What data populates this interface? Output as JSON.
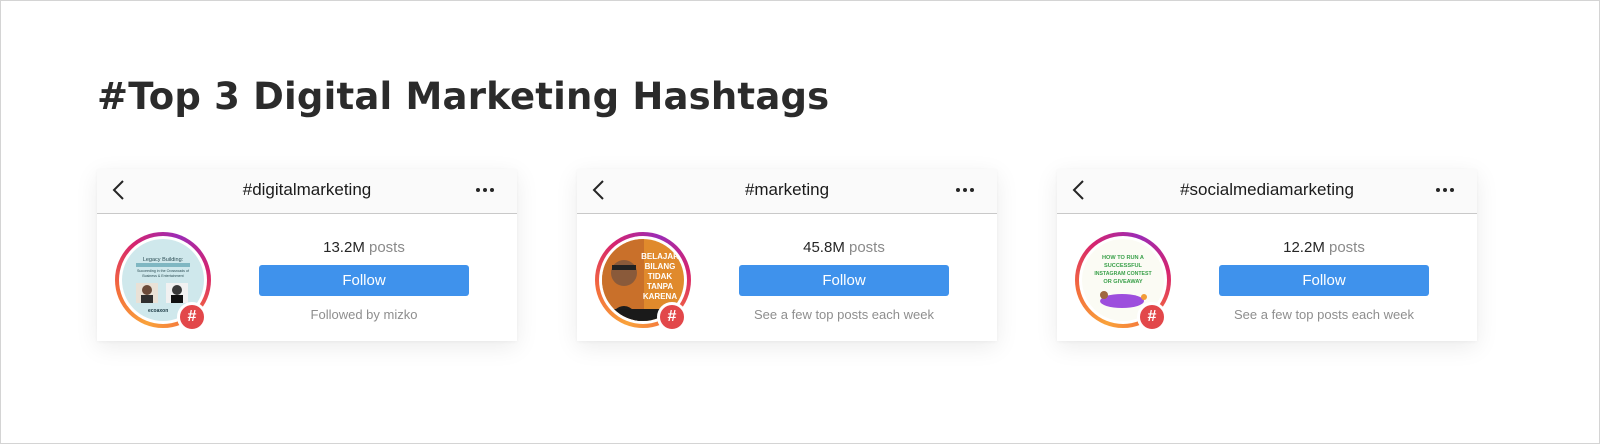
{
  "page_title": "#Top 3 Digital Marketing Hashtags",
  "colors": {
    "follow_button": "#3f92ec",
    "hashtag_badge": "#e2474a",
    "title_text": "#2b2b2b"
  },
  "cards": [
    {
      "hashtag": "#digitalmarketing",
      "post_count": "13.2M",
      "posts_label": "posts",
      "follow_label": "Follow",
      "subtitle": "Followed by mizko",
      "badge_symbol": "#",
      "avatar_icon": "webinar-poster-thumbnail",
      "avatar_text": [
        "Legacy Building:",
        "Succeeding in the Crossroads of",
        "Business & Entertainment",
        "ecoaxon"
      ]
    },
    {
      "hashtag": "#marketing",
      "post_count": "45.8M",
      "posts_label": "posts",
      "follow_label": "Follow",
      "subtitle": "See a few top posts each week",
      "badge_symbol": "#",
      "avatar_icon": "book-cover-thumbnail",
      "avatar_text": [
        "BELAJAR",
        "BILANG",
        "TIDAK",
        "TANPA",
        "KARENA"
      ]
    },
    {
      "hashtag": "#socialmediamarketing",
      "post_count": "12.2M",
      "posts_label": "posts",
      "follow_label": "Follow",
      "subtitle": "See a few top posts each week",
      "badge_symbol": "#",
      "avatar_icon": "contest-graphic-thumbnail",
      "avatar_text": [
        "HOW TO RUN A",
        "SUCCESSFUL",
        "INSTAGRAM CONTEST",
        "OR GIVEAWAY"
      ]
    }
  ]
}
